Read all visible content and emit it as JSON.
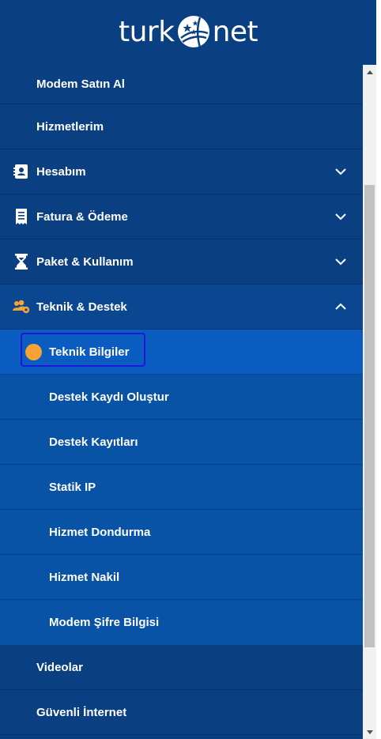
{
  "brand": {
    "part1": "turk",
    "part2": "net"
  },
  "menu": {
    "top_items": [
      {
        "label": "Modem Satın Al"
      },
      {
        "label": "Hizmetlerim"
      },
      {
        "label": "Hesabım",
        "icon": "contact-book-icon",
        "expanded": false
      },
      {
        "label": "Fatura & Ödeme",
        "icon": "receipt-icon",
        "expanded": false
      },
      {
        "label": "Paket & Kullanım",
        "icon": "hourglass-icon",
        "expanded": false
      },
      {
        "label": "Teknik & Destek",
        "icon": "users-gear-icon",
        "expanded": true
      }
    ],
    "sub_items": [
      {
        "label": "Teknik Bilgiler",
        "active": true
      },
      {
        "label": "Destek Kaydı Oluştur"
      },
      {
        "label": "Destek Kayıtları"
      },
      {
        "label": "Statik IP"
      },
      {
        "label": "Hizmet Dondurma"
      },
      {
        "label": "Hizmet Nakil"
      },
      {
        "label": "Modem Şifre Bilgisi"
      }
    ],
    "bottom_items": [
      {
        "label": "Videolar"
      },
      {
        "label": "Güvenli İnternet"
      }
    ]
  },
  "colors": {
    "sidebar_bg": "#0a3f82",
    "submenu_bg": "#0953a6",
    "active_bg": "#0a5cc0",
    "active_dot": "#f7a234",
    "accent_icon": "#f7a234",
    "annotation": "#1c18d6"
  }
}
